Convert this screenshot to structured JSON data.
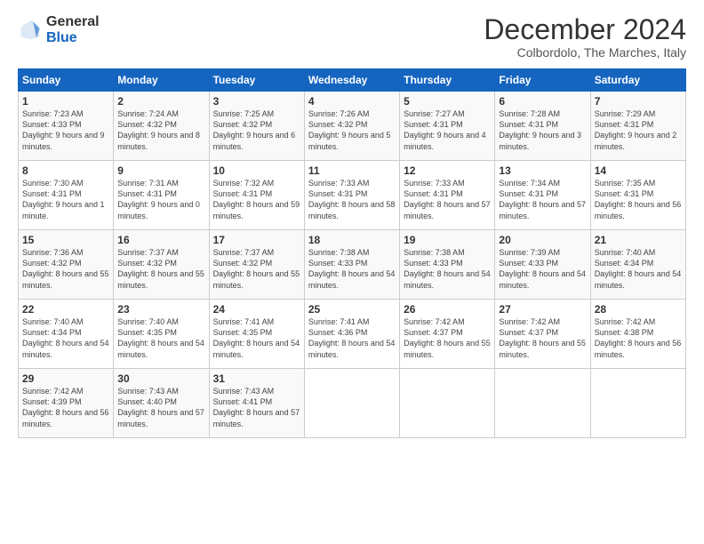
{
  "header": {
    "logo_general": "General",
    "logo_blue": "Blue",
    "month_title": "December 2024",
    "location": "Colbordolo, The Marches, Italy"
  },
  "weekdays": [
    "Sunday",
    "Monday",
    "Tuesday",
    "Wednesday",
    "Thursday",
    "Friday",
    "Saturday"
  ],
  "weeks": [
    [
      {
        "day": "1",
        "sunrise": "Sunrise: 7:23 AM",
        "sunset": "Sunset: 4:33 PM",
        "daylight": "Daylight: 9 hours and 9 minutes."
      },
      {
        "day": "2",
        "sunrise": "Sunrise: 7:24 AM",
        "sunset": "Sunset: 4:32 PM",
        "daylight": "Daylight: 9 hours and 8 minutes."
      },
      {
        "day": "3",
        "sunrise": "Sunrise: 7:25 AM",
        "sunset": "Sunset: 4:32 PM",
        "daylight": "Daylight: 9 hours and 6 minutes."
      },
      {
        "day": "4",
        "sunrise": "Sunrise: 7:26 AM",
        "sunset": "Sunset: 4:32 PM",
        "daylight": "Daylight: 9 hours and 5 minutes."
      },
      {
        "day": "5",
        "sunrise": "Sunrise: 7:27 AM",
        "sunset": "Sunset: 4:31 PM",
        "daylight": "Daylight: 9 hours and 4 minutes."
      },
      {
        "day": "6",
        "sunrise": "Sunrise: 7:28 AM",
        "sunset": "Sunset: 4:31 PM",
        "daylight": "Daylight: 9 hours and 3 minutes."
      },
      {
        "day": "7",
        "sunrise": "Sunrise: 7:29 AM",
        "sunset": "Sunset: 4:31 PM",
        "daylight": "Daylight: 9 hours and 2 minutes."
      }
    ],
    [
      {
        "day": "8",
        "sunrise": "Sunrise: 7:30 AM",
        "sunset": "Sunset: 4:31 PM",
        "daylight": "Daylight: 9 hours and 1 minute."
      },
      {
        "day": "9",
        "sunrise": "Sunrise: 7:31 AM",
        "sunset": "Sunset: 4:31 PM",
        "daylight": "Daylight: 9 hours and 0 minutes."
      },
      {
        "day": "10",
        "sunrise": "Sunrise: 7:32 AM",
        "sunset": "Sunset: 4:31 PM",
        "daylight": "Daylight: 8 hours and 59 minutes."
      },
      {
        "day": "11",
        "sunrise": "Sunrise: 7:33 AM",
        "sunset": "Sunset: 4:31 PM",
        "daylight": "Daylight: 8 hours and 58 minutes."
      },
      {
        "day": "12",
        "sunrise": "Sunrise: 7:33 AM",
        "sunset": "Sunset: 4:31 PM",
        "daylight": "Daylight: 8 hours and 57 minutes."
      },
      {
        "day": "13",
        "sunrise": "Sunrise: 7:34 AM",
        "sunset": "Sunset: 4:31 PM",
        "daylight": "Daylight: 8 hours and 57 minutes."
      },
      {
        "day": "14",
        "sunrise": "Sunrise: 7:35 AM",
        "sunset": "Sunset: 4:31 PM",
        "daylight": "Daylight: 8 hours and 56 minutes."
      }
    ],
    [
      {
        "day": "15",
        "sunrise": "Sunrise: 7:36 AM",
        "sunset": "Sunset: 4:32 PM",
        "daylight": "Daylight: 8 hours and 55 minutes."
      },
      {
        "day": "16",
        "sunrise": "Sunrise: 7:37 AM",
        "sunset": "Sunset: 4:32 PM",
        "daylight": "Daylight: 8 hours and 55 minutes."
      },
      {
        "day": "17",
        "sunrise": "Sunrise: 7:37 AM",
        "sunset": "Sunset: 4:32 PM",
        "daylight": "Daylight: 8 hours and 55 minutes."
      },
      {
        "day": "18",
        "sunrise": "Sunrise: 7:38 AM",
        "sunset": "Sunset: 4:33 PM",
        "daylight": "Daylight: 8 hours and 54 minutes."
      },
      {
        "day": "19",
        "sunrise": "Sunrise: 7:38 AM",
        "sunset": "Sunset: 4:33 PM",
        "daylight": "Daylight: 8 hours and 54 minutes."
      },
      {
        "day": "20",
        "sunrise": "Sunrise: 7:39 AM",
        "sunset": "Sunset: 4:33 PM",
        "daylight": "Daylight: 8 hours and 54 minutes."
      },
      {
        "day": "21",
        "sunrise": "Sunrise: 7:40 AM",
        "sunset": "Sunset: 4:34 PM",
        "daylight": "Daylight: 8 hours and 54 minutes."
      }
    ],
    [
      {
        "day": "22",
        "sunrise": "Sunrise: 7:40 AM",
        "sunset": "Sunset: 4:34 PM",
        "daylight": "Daylight: 8 hours and 54 minutes."
      },
      {
        "day": "23",
        "sunrise": "Sunrise: 7:40 AM",
        "sunset": "Sunset: 4:35 PM",
        "daylight": "Daylight: 8 hours and 54 minutes."
      },
      {
        "day": "24",
        "sunrise": "Sunrise: 7:41 AM",
        "sunset": "Sunset: 4:35 PM",
        "daylight": "Daylight: 8 hours and 54 minutes."
      },
      {
        "day": "25",
        "sunrise": "Sunrise: 7:41 AM",
        "sunset": "Sunset: 4:36 PM",
        "daylight": "Daylight: 8 hours and 54 minutes."
      },
      {
        "day": "26",
        "sunrise": "Sunrise: 7:42 AM",
        "sunset": "Sunset: 4:37 PM",
        "daylight": "Daylight: 8 hours and 55 minutes."
      },
      {
        "day": "27",
        "sunrise": "Sunrise: 7:42 AM",
        "sunset": "Sunset: 4:37 PM",
        "daylight": "Daylight: 8 hours and 55 minutes."
      },
      {
        "day": "28",
        "sunrise": "Sunrise: 7:42 AM",
        "sunset": "Sunset: 4:38 PM",
        "daylight": "Daylight: 8 hours and 56 minutes."
      }
    ],
    [
      {
        "day": "29",
        "sunrise": "Sunrise: 7:42 AM",
        "sunset": "Sunset: 4:39 PM",
        "daylight": "Daylight: 8 hours and 56 minutes."
      },
      {
        "day": "30",
        "sunrise": "Sunrise: 7:43 AM",
        "sunset": "Sunset: 4:40 PM",
        "daylight": "Daylight: 8 hours and 57 minutes."
      },
      {
        "day": "31",
        "sunrise": "Sunrise: 7:43 AM",
        "sunset": "Sunset: 4:41 PM",
        "daylight": "Daylight: 8 hours and 57 minutes."
      },
      null,
      null,
      null,
      null
    ]
  ]
}
